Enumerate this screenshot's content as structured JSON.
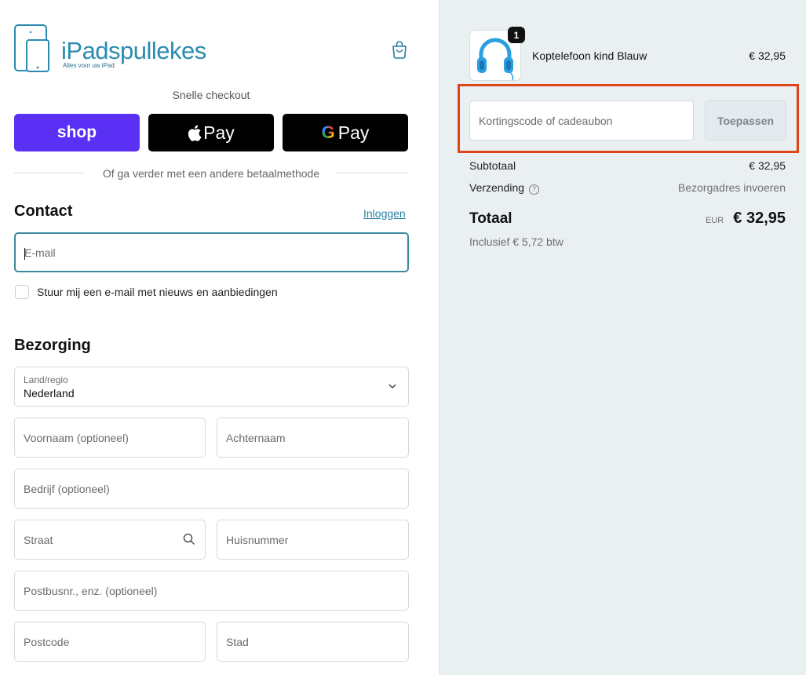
{
  "brand": {
    "name": "iPadspullekes",
    "tagline": "Alles voor uw iPad",
    "accent": "#2b8bb0"
  },
  "header": {
    "cart_icon": "shopping-bag-icon"
  },
  "express": {
    "title": "Snelle checkout",
    "shop_label": "shop",
    "apple_label": "Pay",
    "google_label": "Pay",
    "google_letter": "G",
    "divider_text": "Of ga verder met een andere betaalmethode"
  },
  "contact": {
    "title": "Contact",
    "login_label": "Inloggen",
    "email_placeholder": "E-mail",
    "newsletter_label": "Stuur mij een e-mail met nieuws en aanbiedingen",
    "newsletter_checked": false
  },
  "delivery": {
    "title": "Bezorging",
    "country_label": "Land/regio",
    "country_value": "Nederland",
    "first_name": "Voornaam (optioneel)",
    "last_name": "Achternaam",
    "company": "Bedrijf (optioneel)",
    "street": "Straat",
    "house_number": "Huisnummer",
    "address2": "Postbusnr., enz. (optioneel)",
    "postcode": "Postcode",
    "city": "Stad"
  },
  "summary": {
    "item": {
      "name": "Koptelefoon kind Blauw",
      "price": "€ 32,95",
      "quantity": "1"
    },
    "discount_placeholder": "Kortingscode of cadeaubon",
    "apply_label": "Toepassen",
    "subtotal_label": "Subtotaal",
    "subtotal_value": "€ 32,95",
    "shipping_label": "Verzending",
    "shipping_value": "Bezorgadres invoeren",
    "total_label": "Totaal",
    "total_currency": "EUR",
    "total_value": "€ 32,95",
    "tax_note": "Inclusief € 5,72 btw"
  },
  "colors": {
    "shop_purple": "#5a31f4",
    "highlight": "#e0451a",
    "summary_bg": "#eaf0f2"
  }
}
